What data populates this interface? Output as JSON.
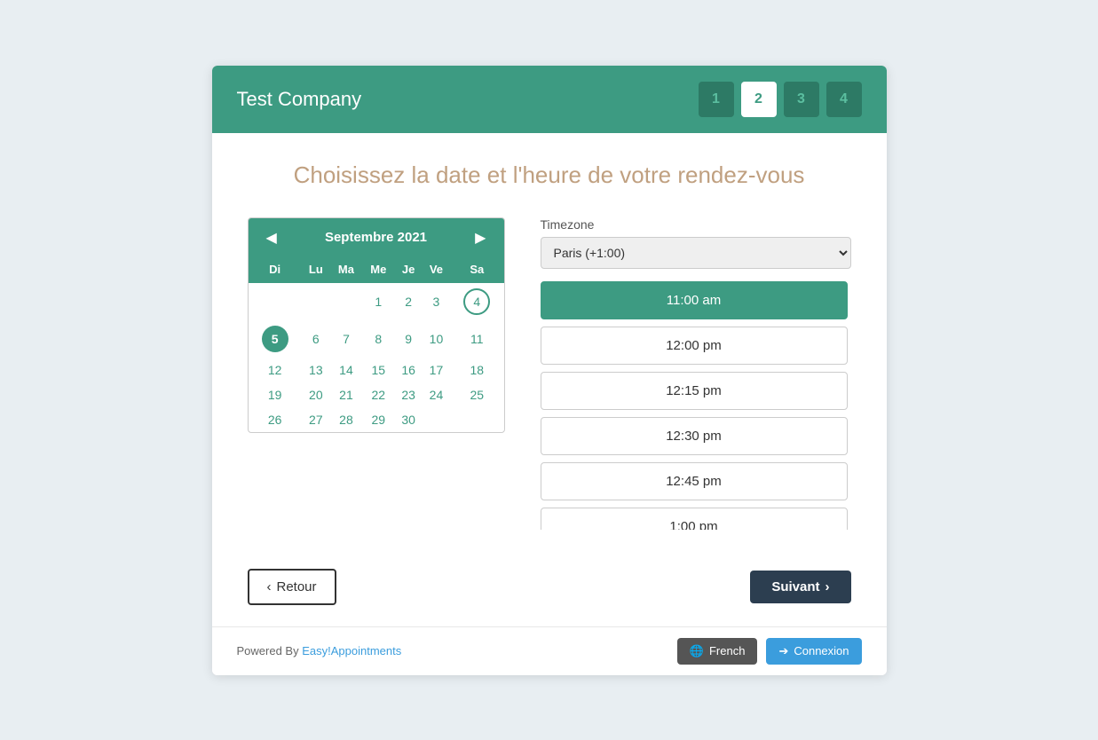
{
  "header": {
    "title": "Test Company",
    "steps": [
      {
        "label": "1",
        "active": false
      },
      {
        "label": "2",
        "active": true
      },
      {
        "label": "3",
        "active": false
      },
      {
        "label": "4",
        "active": false
      }
    ]
  },
  "page": {
    "title": "Choisissez la date et l'heure de votre rendez-vous"
  },
  "calendar": {
    "month": "Septembre 2021",
    "days_header": [
      "Di",
      "Lu",
      "Ma",
      "Me",
      "Je",
      "Ve",
      "Sa"
    ],
    "weeks": [
      [
        "",
        "",
        "",
        "1",
        "2",
        "3",
        "4"
      ],
      [
        "5",
        "6",
        "7",
        "8",
        "9",
        "10",
        "11"
      ],
      [
        "12",
        "13",
        "14",
        "15",
        "16",
        "17",
        "18"
      ],
      [
        "19",
        "20",
        "21",
        "22",
        "23",
        "24",
        "25"
      ],
      [
        "26",
        "27",
        "28",
        "29",
        "30",
        "",
        ""
      ]
    ],
    "today": "5",
    "available_circle": "4"
  },
  "timezone": {
    "label": "Timezone",
    "value": "Paris (+1:00)"
  },
  "time_slots": [
    {
      "time": "11:00 am",
      "selected": true
    },
    {
      "time": "12:00 pm",
      "selected": false
    },
    {
      "time": "12:15 pm",
      "selected": false
    },
    {
      "time": "12:30 pm",
      "selected": false
    },
    {
      "time": "12:45 pm",
      "selected": false
    },
    {
      "time": "1:00 pm",
      "selected": false
    }
  ],
  "navigation": {
    "back_label": "Retour",
    "next_label": "Suivant"
  },
  "footer": {
    "powered_by_text": "Powered By",
    "powered_by_link": "Easy!Appointments",
    "lang_label": "French",
    "connexion_label": "Connexion"
  }
}
